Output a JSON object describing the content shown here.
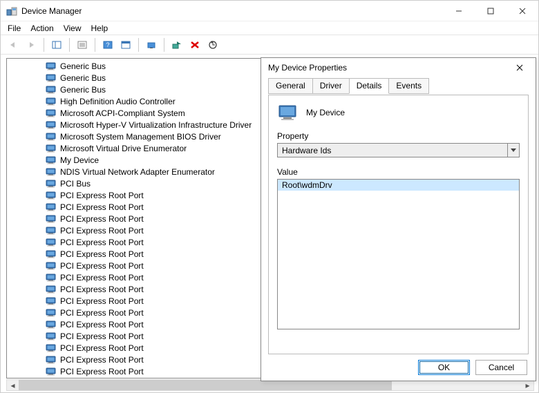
{
  "window": {
    "title": "Device Manager"
  },
  "menu": {
    "file": "File",
    "action": "Action",
    "view": "View",
    "help": "Help"
  },
  "tree": {
    "items": [
      "Generic Bus",
      "Generic Bus",
      "Generic Bus",
      "High Definition Audio Controller",
      "Microsoft ACPI-Compliant System",
      "Microsoft Hyper-V Virtualization Infrastructure Driver",
      "Microsoft System Management BIOS Driver",
      "Microsoft Virtual Drive Enumerator",
      "My Device",
      "NDIS Virtual Network Adapter Enumerator",
      "PCI Bus",
      "PCI Express Root Port",
      "PCI Express Root Port",
      "PCI Express Root Port",
      "PCI Express Root Port",
      "PCI Express Root Port",
      "PCI Express Root Port",
      "PCI Express Root Port",
      "PCI Express Root Port",
      "PCI Express Root Port",
      "PCI Express Root Port",
      "PCI Express Root Port",
      "PCI Express Root Port",
      "PCI Express Root Port",
      "PCI Express Root Port",
      "PCI Express Root Port",
      "PCI Express Root Port"
    ]
  },
  "dialog": {
    "title": "My Device Properties",
    "tabs": {
      "general": "General",
      "driver": "Driver",
      "details": "Details",
      "events": "Events"
    },
    "device_name": "My Device",
    "property_label": "Property",
    "property_value": "Hardware Ids",
    "value_label": "Value",
    "value_items": [
      "Root\\wdmDrv"
    ],
    "ok": "OK",
    "cancel": "Cancel"
  }
}
